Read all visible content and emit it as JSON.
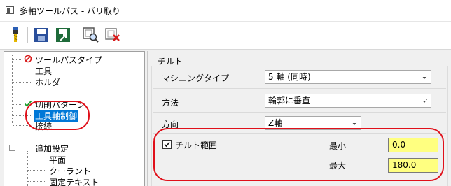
{
  "window": {
    "title": "多軸ツールパス - バリ取り"
  },
  "toolbar": {
    "icons": [
      "tool-icon",
      "save-icon",
      "save-as-icon",
      "preview-icon",
      "delete-icon"
    ]
  },
  "tree": {
    "items": {
      "toolpath_type": "ツールパスタイプ",
      "tool": "工具",
      "holder": "ホルダ",
      "cut_pattern": "切削パターン",
      "tool_axis_control": "工具軸制御",
      "link": "接続",
      "additional_settings": "追加設定",
      "plane": "平面",
      "coolant": "クーラント",
      "fixed_text": "固定テキスト"
    }
  },
  "tilt": {
    "group_label": "チルト",
    "machining_type": {
      "label": "マシニングタイプ",
      "value": "5 軸 (同時)"
    },
    "method": {
      "label": "方法",
      "value": "輪郭に垂直"
    },
    "direction": {
      "label": "方向",
      "value": "Z軸"
    },
    "tilt_range": {
      "label": "チルト範囲",
      "checked": true,
      "min_label": "最小",
      "min_value": "0.0",
      "max_label": "最大",
      "max_value": "180.0"
    }
  },
  "colors": {
    "annotation": "#e0101a",
    "selection": "#0078d7",
    "input_highlight": "#ffff80"
  }
}
